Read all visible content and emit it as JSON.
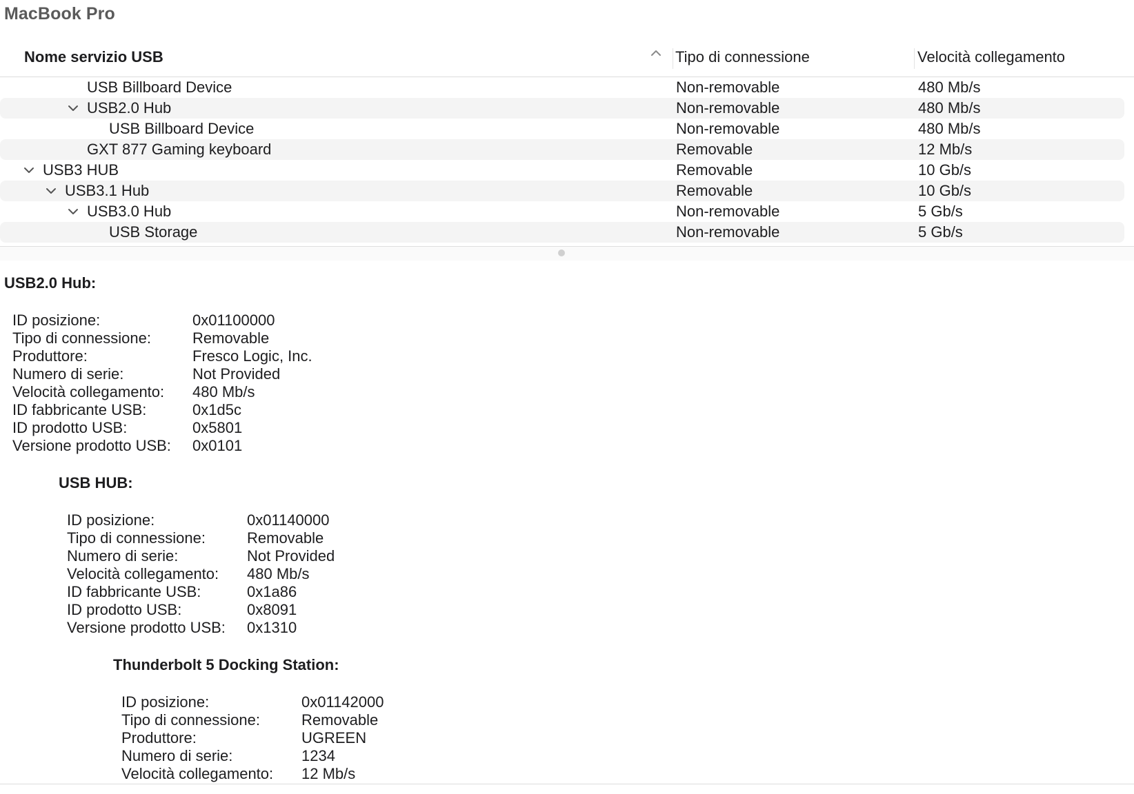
{
  "window": {
    "title": "MacBook Pro"
  },
  "columns": {
    "name": "Nome servizio USB",
    "connection": "Tipo di connessione",
    "speed": "Velocità collegamento"
  },
  "rows": [
    {
      "name": "USB Billboard Device",
      "connection": "Non-removable",
      "speed": "480 Mb/s",
      "level": 3,
      "expandable": false
    },
    {
      "name": "USB2.0 Hub",
      "connection": "Non-removable",
      "speed": "480 Mb/s",
      "level": 3,
      "expandable": true,
      "expanded": true
    },
    {
      "name": "USB Billboard Device",
      "connection": "Non-removable",
      "speed": "480 Mb/s",
      "level": 4,
      "expandable": false
    },
    {
      "name": "GXT 877 Gaming keyboard",
      "connection": "Removable",
      "speed": "12 Mb/s",
      "level": 3,
      "expandable": false
    },
    {
      "name": "USB3 HUB",
      "connection": "Removable",
      "speed": "10 Gb/s",
      "level": 1,
      "expandable": true,
      "expanded": true
    },
    {
      "name": "USB3.1 Hub",
      "connection": "Removable",
      "speed": "10 Gb/s",
      "level": 2,
      "expandable": true,
      "expanded": true
    },
    {
      "name": "USB3.0 Hub",
      "connection": "Non-removable",
      "speed": "5 Gb/s",
      "level": 3,
      "expandable": true,
      "expanded": true
    },
    {
      "name": "USB Storage",
      "connection": "Non-removable",
      "speed": "5 Gb/s",
      "level": 4,
      "expandable": false
    }
  ],
  "detail": {
    "sections": [
      {
        "title": "USB2.0 Hub:",
        "indent": 0,
        "fields": [
          {
            "label": "ID posizione:",
            "value": "0x01100000"
          },
          {
            "label": "Tipo di connessione:",
            "value": "Removable"
          },
          {
            "label": "Produttore:",
            "value": "Fresco Logic, Inc."
          },
          {
            "label": "Numero di serie:",
            "value": "Not Provided"
          },
          {
            "label": "Velocità collegamento:",
            "value": "480 Mb/s"
          },
          {
            "label": "ID fabbricante USB:",
            "value": "0x1d5c"
          },
          {
            "label": "ID prodotto USB:",
            "value": "0x5801"
          },
          {
            "label": "Versione prodotto USB:",
            "value": "0x0101"
          }
        ]
      },
      {
        "title": "USB HUB:",
        "indent": 1,
        "fields": [
          {
            "label": "ID posizione:",
            "value": "0x01140000"
          },
          {
            "label": "Tipo di connessione:",
            "value": "Removable"
          },
          {
            "label": "Numero di serie:",
            "value": "Not Provided"
          },
          {
            "label": "Velocità collegamento:",
            "value": "480 Mb/s"
          },
          {
            "label": "ID fabbricante USB:",
            "value": "0x1a86"
          },
          {
            "label": "ID prodotto USB:",
            "value": "0x8091"
          },
          {
            "label": "Versione prodotto USB:",
            "value": "0x1310"
          }
        ]
      },
      {
        "title": "Thunderbolt 5 Docking Station:",
        "indent": 2,
        "fields": [
          {
            "label": "ID posizione:",
            "value": "0x01142000"
          },
          {
            "label": "Tipo di connessione:",
            "value": "Removable"
          },
          {
            "label": "Produttore:",
            "value": "UGREEN"
          },
          {
            "label": "Numero di serie:",
            "value": "1234"
          },
          {
            "label": "Velocità collegamento:",
            "value": "12 Mb/s"
          }
        ]
      }
    ]
  },
  "icons": {
    "sort": "chevron-up-icon",
    "disclosure": "chevron-down-icon"
  }
}
